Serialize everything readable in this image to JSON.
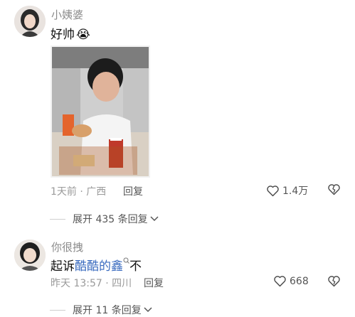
{
  "comments": [
    {
      "username": "小姨婆",
      "text": "好帅",
      "emoji": "😭",
      "time": "1天前 · 广西",
      "reply_label": "回复",
      "likes": "1.4万",
      "expand_label": "展开 435 条回复"
    },
    {
      "username": "你很拽",
      "text_prefix": "起诉",
      "mention": "酷酷的鑫",
      "text_suffix": "不",
      "time": "昨天 13:57 · 四川",
      "reply_label": "回复",
      "likes": "668",
      "expand_label": "展开 11 条回复"
    }
  ],
  "colors": {
    "mention": "#3a6bbf",
    "meta": "#9a9a9a"
  }
}
